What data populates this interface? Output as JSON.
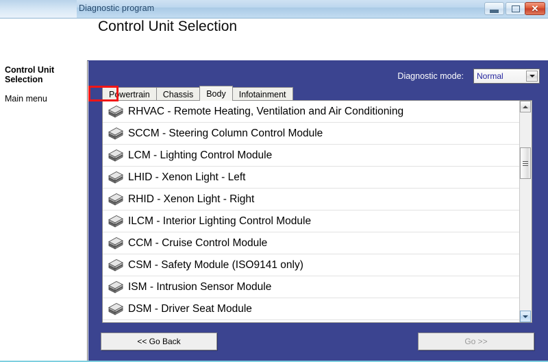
{
  "window": {
    "title": "Diagnostic program",
    "controls": {
      "minimize": "minimize",
      "maximize": "maximize",
      "close": "✕"
    }
  },
  "header": {
    "page_title": "Control Unit Selection"
  },
  "sidebar": {
    "title": "Control Unit Selection",
    "items": [
      {
        "label": "Main menu"
      }
    ]
  },
  "diagnostic_mode": {
    "label": "Diagnostic mode:",
    "value": "Normal",
    "options": [
      "Normal"
    ]
  },
  "tabs": [
    {
      "label": "Powertrain",
      "selected": false
    },
    {
      "label": "Chassis",
      "selected": false
    },
    {
      "label": "Body",
      "selected": true
    },
    {
      "label": "Infotainment",
      "selected": false
    }
  ],
  "annotation": {
    "highlight_color": "#f21616",
    "target": "Body"
  },
  "control_units": [
    {
      "icon": "module-icon",
      "label": "RHVAC - Remote Heating, Ventilation and Air Conditioning"
    },
    {
      "icon": "module-icon",
      "label": "SCCM - Steering Column Control Module"
    },
    {
      "icon": "module-icon",
      "label": "LCM - Lighting Control Module"
    },
    {
      "icon": "module-icon",
      "label": "LHID - Xenon Light - Left"
    },
    {
      "icon": "module-icon",
      "label": "RHID - Xenon Light - Right"
    },
    {
      "icon": "module-icon",
      "label": "ILCM - Interior Lighting Control Module"
    },
    {
      "icon": "module-icon",
      "label": "CCM - Cruise Control Module"
    },
    {
      "icon": "module-icon",
      "label": "CSM - Safety Module (ISO9141 only)"
    },
    {
      "icon": "module-icon",
      "label": "ISM - Intrusion Sensor Module"
    },
    {
      "icon": "module-icon",
      "label": "DSM - Driver Seat Module"
    }
  ],
  "scrollbar": {
    "up_icon": "triangle-up-icon",
    "down_icon": "triangle-down-icon"
  },
  "footer": {
    "back_label": "<< Go Back",
    "go_label": "Go >>",
    "go_enabled": false
  },
  "colors": {
    "panel_blue": "#3b4490",
    "titlebar_blue": "#bcd7ee",
    "close_red": "#c8412a",
    "dropdown_text": "#23239e",
    "annotation_red": "#f21616"
  }
}
